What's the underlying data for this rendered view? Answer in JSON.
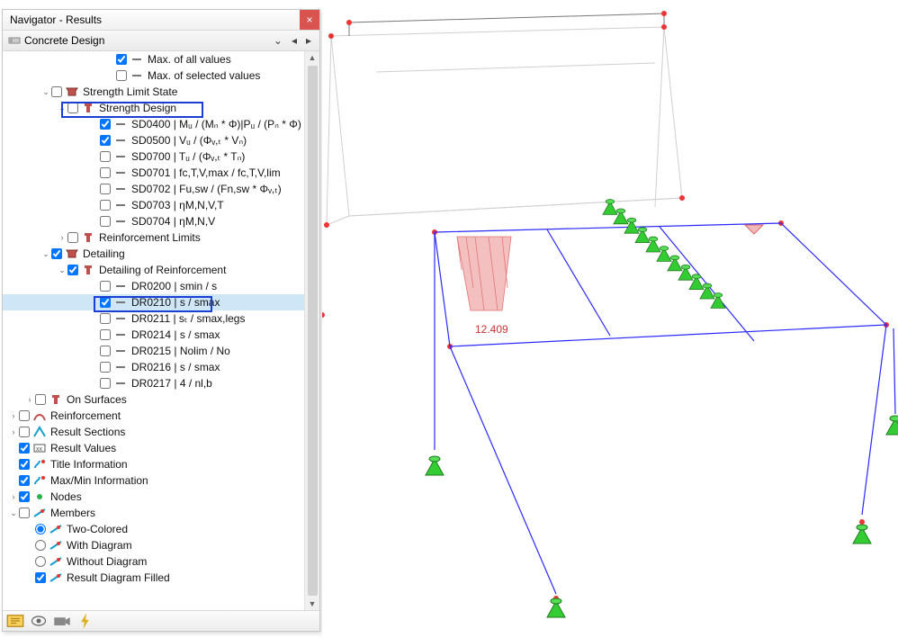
{
  "window": {
    "title": "Navigator - Results",
    "section": "Concrete Design"
  },
  "annotation": "12.409",
  "colors": {
    "selectRow": "#cfe6f7",
    "highlightBox": "#1a3fd6",
    "support": "#33cc33",
    "line": "#2a2aff"
  },
  "footer": [
    "display-options",
    "visibility",
    "camera",
    "lightning"
  ],
  "tree": [
    {
      "indent": 6,
      "twist": "",
      "check": true,
      "icon": "dash",
      "label": "Max. of all values"
    },
    {
      "indent": 6,
      "twist": "",
      "check": false,
      "icon": "dash",
      "label": "Max. of selected values"
    },
    {
      "indent": 2,
      "twist": "v",
      "check": false,
      "icon": "mhat",
      "label": "Strength Limit State"
    },
    {
      "indent": 3,
      "twist": "v",
      "check": false,
      "icon": "tee",
      "label": "Strength Design"
    },
    {
      "indent": 5,
      "twist": "",
      "check": true,
      "icon": "dash",
      "label": "SD0400 | Mᵤ / (Mₙ * Φ)|Pᵤ / (Pₙ * Φ)"
    },
    {
      "indent": 5,
      "twist": "",
      "check": true,
      "icon": "dash",
      "label": "SD0500 | Vᵤ / (Φᵥ,ₜ * Vₙ)"
    },
    {
      "indent": 5,
      "twist": "",
      "check": false,
      "icon": "dash",
      "label": "SD0700 | Tᵤ / (Φᵥ,ₜ * Tₙ)"
    },
    {
      "indent": 5,
      "twist": "",
      "check": false,
      "icon": "dash",
      "label": "SD0701 | fc,T,V,max / fc,T,V,lim"
    },
    {
      "indent": 5,
      "twist": "",
      "check": false,
      "icon": "dash",
      "label": "SD0702 | Fu,sw / (Fn,sw * Φᵥ,ₜ)"
    },
    {
      "indent": 5,
      "twist": "",
      "check": false,
      "icon": "dash",
      "label": "SD0703 | ηM,N,V,T"
    },
    {
      "indent": 5,
      "twist": "",
      "check": false,
      "icon": "dash",
      "label": "SD0704 | ηM,N,V"
    },
    {
      "indent": 3,
      "twist": ">",
      "check": false,
      "icon": "tee",
      "label": "Reinforcement Limits"
    },
    {
      "indent": 2,
      "twist": "v",
      "check": true,
      "icon": "mhat",
      "label": "Detailing"
    },
    {
      "indent": 3,
      "twist": "v",
      "check": true,
      "icon": "tee",
      "label": "Detailing of Reinforcement"
    },
    {
      "indent": 5,
      "twist": "",
      "check": false,
      "icon": "dash",
      "label": "DR0200 | smin / s"
    },
    {
      "indent": 5,
      "twist": "",
      "check": true,
      "icon": "dash",
      "label": "DR0210 | s / smax",
      "selected": true
    },
    {
      "indent": 5,
      "twist": "",
      "check": false,
      "icon": "dash",
      "label": "DR0211 | sₜ / smax,legs"
    },
    {
      "indent": 5,
      "twist": "",
      "check": false,
      "icon": "dash",
      "label": "DR0214 | s / smax"
    },
    {
      "indent": 5,
      "twist": "",
      "check": false,
      "icon": "dash",
      "label": "DR0215 | Nolim / No"
    },
    {
      "indent": 5,
      "twist": "",
      "check": false,
      "icon": "dash",
      "label": "DR0216 | s / smax"
    },
    {
      "indent": 5,
      "twist": "",
      "check": false,
      "icon": "dash",
      "label": "DR0217 | 4 / nl,b"
    },
    {
      "indent": 1,
      "twist": ">",
      "check": false,
      "icon": "tee",
      "label": "On Surfaces"
    },
    {
      "indent": 0,
      "twist": ">",
      "check": false,
      "icon": "rebar",
      "label": "Reinforcement"
    },
    {
      "indent": 0,
      "twist": ">",
      "check": false,
      "icon": "sect",
      "label": "Result Sections"
    },
    {
      "indent": 0,
      "twist": "",
      "check": true,
      "icon": "vals",
      "label": "Result Values"
    },
    {
      "indent": 0,
      "twist": "",
      "check": true,
      "icon": "title",
      "label": "Title Information"
    },
    {
      "indent": 0,
      "twist": "",
      "check": true,
      "icon": "title",
      "label": "Max/Min Information"
    },
    {
      "indent": 0,
      "twist": ">",
      "check": true,
      "icon": "node",
      "label": "Nodes"
    },
    {
      "indent": 0,
      "twist": "v",
      "check": false,
      "icon": "memb",
      "label": "Members"
    },
    {
      "indent": 1,
      "twist": "",
      "radio": true,
      "checked": true,
      "icon": "memb",
      "label": "Two-Colored"
    },
    {
      "indent": 1,
      "twist": "",
      "radio": true,
      "checked": false,
      "icon": "memb",
      "label": "With Diagram"
    },
    {
      "indent": 1,
      "twist": "",
      "radio": true,
      "checked": false,
      "icon": "memb",
      "label": "Without Diagram"
    },
    {
      "indent": 1,
      "twist": "",
      "check": true,
      "icon": "memb",
      "label": "Result Diagram Filled"
    }
  ]
}
